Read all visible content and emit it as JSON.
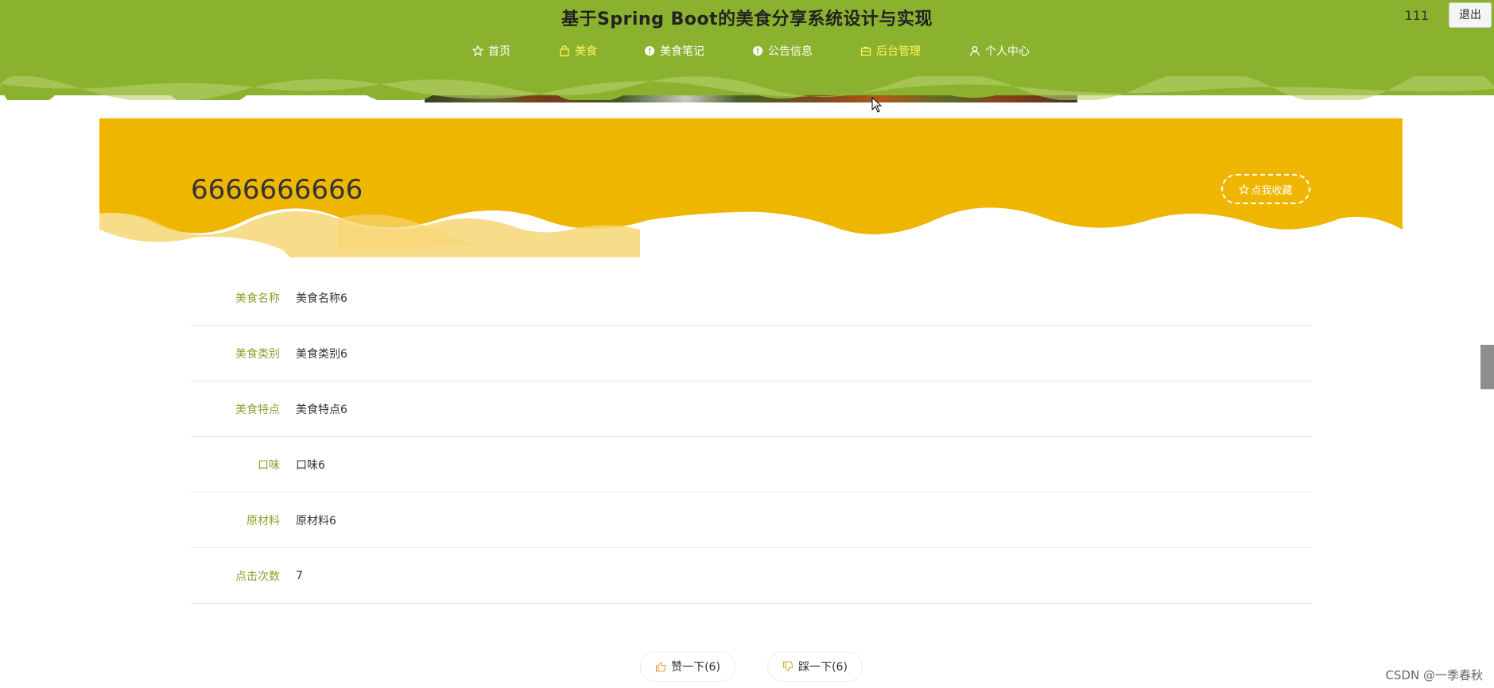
{
  "header": {
    "site_title": "基于Spring Boot的美食分享系统设计与实现",
    "user_name": "111",
    "logout_label": "退出",
    "nav": [
      {
        "label": "首页",
        "icon": "star-icon",
        "active": false
      },
      {
        "label": "美食",
        "icon": "bag-icon",
        "active": true
      },
      {
        "label": "美食笔记",
        "icon": "info-circle-icon",
        "active": false
      },
      {
        "label": "公告信息",
        "icon": "info-circle-icon",
        "active": false
      },
      {
        "label": "后台管理",
        "icon": "briefcase-icon",
        "active": true
      },
      {
        "label": "个人中心",
        "icon": "user-icon",
        "active": false
      }
    ]
  },
  "detail": {
    "title": "6666666666",
    "fav_label": "点我收藏",
    "fields": [
      {
        "label": "美食名称",
        "value": "美食名称6"
      },
      {
        "label": "美食类别",
        "value": "美食类别6"
      },
      {
        "label": "美食特点",
        "value": "美食特点6"
      },
      {
        "label": "口味",
        "value": "口味6"
      },
      {
        "label": "原材料",
        "value": "原材料6"
      },
      {
        "label": "点击次数",
        "value": "7"
      }
    ]
  },
  "votes": {
    "like_label": "赞一下(6)",
    "dislike_label": "踩一下(6)"
  },
  "watermark": "CSDN @一季春秋",
  "colors": {
    "header_green": "#8bb22e",
    "accent_yellow": "#efb600",
    "active_nav": "#fff45a",
    "label_green": "#8aa32e"
  }
}
